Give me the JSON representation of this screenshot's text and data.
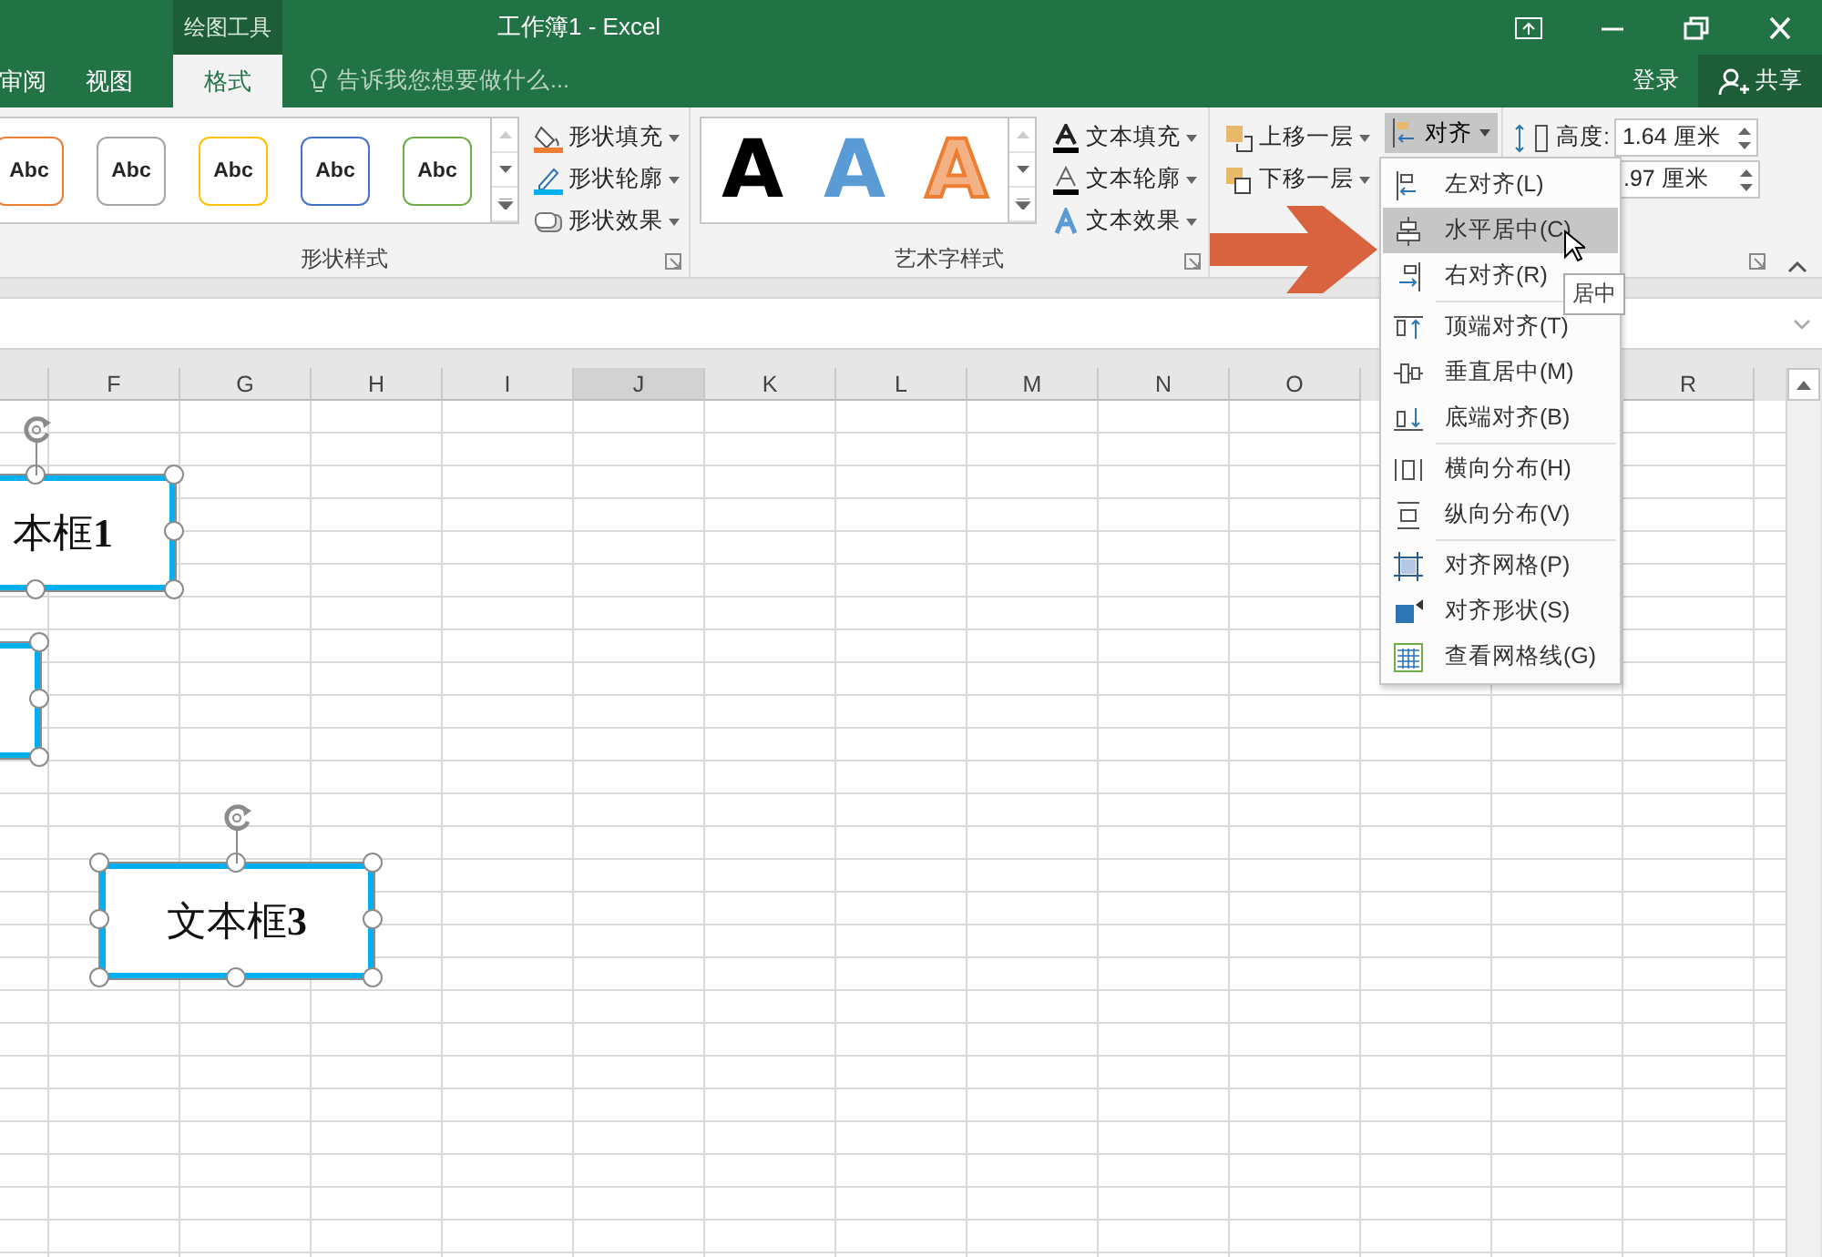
{
  "title_bar": {
    "context_tab": "绘图工具",
    "title": "工作簿1 - Excel"
  },
  "tabs": [
    {
      "label": "审阅",
      "selected": false
    },
    {
      "label": "视图",
      "selected": false
    },
    {
      "label": "格式",
      "selected": true
    }
  ],
  "tell_me": {
    "placeholder": "告诉我您想要做什么..."
  },
  "account": {
    "sign_in": "登录",
    "share": "共享"
  },
  "shape_styles": {
    "presets": [
      {
        "label": "Abc",
        "color": "#ed7d31"
      },
      {
        "label": "Abc",
        "color": "#a5a5a5"
      },
      {
        "label": "Abc",
        "color": "#ffc000"
      },
      {
        "label": "Abc",
        "color": "#4472c4"
      },
      {
        "label": "Abc",
        "color": "#70ad47"
      }
    ],
    "commands": [
      {
        "label": "形状填充",
        "kind": "fill"
      },
      {
        "label": "形状轮廓",
        "kind": "outline"
      },
      {
        "label": "形状效果",
        "kind": "effect"
      }
    ],
    "group_label": "形状样式"
  },
  "wordart_styles": {
    "presets": [
      {
        "label": "A",
        "kind": "solid",
        "color": "#000000"
      },
      {
        "label": "A",
        "kind": "solid",
        "color": "#5b9bd5"
      },
      {
        "label": "A",
        "kind": "outline",
        "color": "#f4b183"
      }
    ],
    "commands": [
      {
        "label": "文本填充",
        "kind": "text_fill"
      },
      {
        "label": "文本轮廓",
        "kind": "text_outline"
      },
      {
        "label": "文本效果",
        "kind": "text_effect"
      }
    ],
    "group_label": "艺术字样式"
  },
  "arrange": {
    "commands": [
      {
        "label": "上移一层",
        "kind": "forward"
      },
      {
        "label": "下移一层",
        "kind": "backward"
      }
    ],
    "align_button": {
      "label": "对齐",
      "expanded": true
    }
  },
  "size": {
    "height": {
      "label": "高度:",
      "value": "1.64 厘米"
    },
    "width": {
      "value": ".97 厘米"
    }
  },
  "columns": [
    {
      "label": "F",
      "selected": false
    },
    {
      "label": "G",
      "selected": false
    },
    {
      "label": "H",
      "selected": false
    },
    {
      "label": "I",
      "selected": false
    },
    {
      "label": "J",
      "selected": true
    },
    {
      "label": "K",
      "selected": false
    },
    {
      "label": "L",
      "selected": false
    },
    {
      "label": "M",
      "selected": false
    },
    {
      "label": "N",
      "selected": false
    },
    {
      "label": "O",
      "selected": false
    }
  ],
  "columns_right": [
    {
      "label": "R",
      "selected": false
    }
  ],
  "text_boxes": [
    {
      "text": "本框**1**",
      "selected": true
    },
    {
      "selected": true
    },
    {
      "text": "文本框**3**",
      "selected": true
    }
  ],
  "align_menu": {
    "groups": [
      [
        {
          "label": "左对齐(L)",
          "kind": "left",
          "selected": false
        },
        {
          "label": "水平居中(C)",
          "kind": "center",
          "selected": true
        },
        {
          "label": "右对齐(R)",
          "kind": "right",
          "selected": false
        }
      ],
      [
        {
          "label": "顶端对齐(T)",
          "kind": "top",
          "selected": false
        },
        {
          "label": "垂直居中(M)",
          "kind": "middle",
          "selected": false
        },
        {
          "label": "底端对齐(B)",
          "kind": "bottom",
          "selected": false
        }
      ],
      [
        {
          "label": "横向分布(H)",
          "kind": "dist_h",
          "selected": false
        },
        {
          "label": "纵向分布(V)",
          "kind": "dist_v",
          "selected": false
        }
      ],
      [
        {
          "label": "对齐网格(P)",
          "kind": "snap_grid",
          "selected": false
        },
        {
          "label": "对齐形状(S)",
          "kind": "snap_shape",
          "selected": false
        },
        {
          "label": "查看网格线(G)",
          "kind": "gridlines",
          "selected": false
        }
      ]
    ],
    "tooltip": "居中"
  }
}
